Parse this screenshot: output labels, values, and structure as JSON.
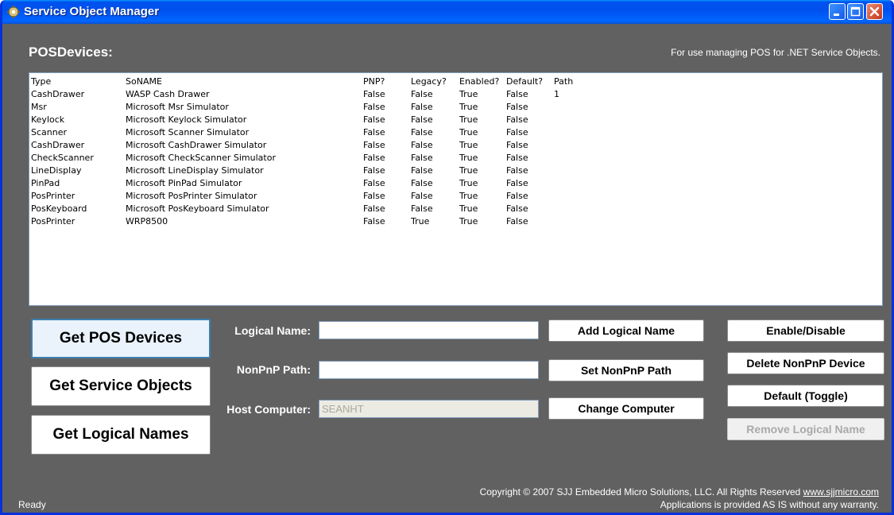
{
  "window": {
    "title": "Service Object Manager",
    "app_icon": "gear-icon",
    "controls": [
      "minimize-icon",
      "maximize-icon",
      "close-icon"
    ]
  },
  "header": {
    "section_label": "POSDevices:",
    "tagline": "For use managing POS for .NET Service Objects."
  },
  "device_list": {
    "headers": [
      "Type",
      "SoNAME",
      "PNP?",
      "Legacy?",
      "Enabled?",
      "Default?",
      "Path"
    ],
    "rows": [
      [
        "CashDrawer",
        "WASP Cash Drawer",
        "False",
        "False",
        "True",
        "False",
        "1"
      ],
      [
        "Msr",
        "Microsoft Msr Simulator",
        "False",
        "False",
        "True",
        "False",
        ""
      ],
      [
        "Keylock",
        "Microsoft Keylock Simulator",
        "False",
        "False",
        "True",
        "False",
        ""
      ],
      [
        "Scanner",
        "Microsoft Scanner Simulator",
        "False",
        "False",
        "True",
        "False",
        ""
      ],
      [
        "CashDrawer",
        "Microsoft CashDrawer Simulator",
        "False",
        "False",
        "True",
        "False",
        ""
      ],
      [
        "CheckScanner",
        "Microsoft CheckScanner Simulator",
        "False",
        "False",
        "True",
        "False",
        ""
      ],
      [
        "LineDisplay",
        "Microsoft LineDisplay Simulator",
        "False",
        "False",
        "True",
        "False",
        ""
      ],
      [
        "PinPad",
        "Microsoft PinPad Simulator",
        "False",
        "False",
        "True",
        "False",
        ""
      ],
      [
        "PosPrinter",
        "Microsoft PosPrinter Simulator",
        "False",
        "False",
        "True",
        "False",
        ""
      ],
      [
        "PosKeyboard",
        "Microsoft PosKeyboard Simulator",
        "False",
        "False",
        "True",
        "False",
        ""
      ],
      [
        "PosPrinter",
        "WRP8500",
        "False",
        "True",
        "True",
        "False",
        ""
      ]
    ]
  },
  "left_buttons": {
    "get_pos_devices": "Get POS Devices",
    "get_service_objects": "Get Service Objects",
    "get_logical_names": "Get Logical Names"
  },
  "fields": {
    "logical_name_label": "Logical Name:",
    "logical_name_value": "",
    "nonpnp_path_label": "NonPnP Path:",
    "nonpnp_path_value": "",
    "host_computer_label": "Host Computer:",
    "host_computer_value": "SEANHT"
  },
  "mid_buttons": {
    "add_logical_name": "Add Logical Name",
    "set_nonpnp_path": "Set NonPnP Path",
    "change_computer": "Change Computer"
  },
  "right_buttons": {
    "enable_disable": "Enable/Disable",
    "delete_nonpnp_device": "Delete NonPnP Device",
    "default_toggle": "Default (Toggle)",
    "remove_logical_name": "Remove Logical Name"
  },
  "footer": {
    "copyright": "Copyright © 2007 SJJ Embedded Micro Solutions, LLC. All Rights Reserved",
    "website": "www.sjjmicro.com",
    "disclaimer": "Applications is provided AS IS without any warranty.",
    "status": "Ready"
  }
}
